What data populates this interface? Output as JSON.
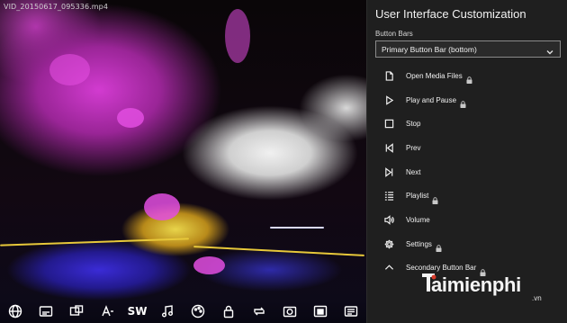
{
  "video": {
    "filename": "VID_20150617_095336.mp4",
    "toolbar": {
      "subtitle_text": "SW",
      "icons": [
        "globe-icon",
        "subtitles-icon",
        "aspect-icon",
        "text-size-icon",
        "music-note-icon",
        "palette-icon",
        "lock-icon",
        "loop-icon",
        "screenshot-icon",
        "picture-in-picture-icon",
        "playlist-screen-icon"
      ]
    }
  },
  "panel": {
    "title": "User Interface Customization",
    "section_label": "Button Bars",
    "dropdown_value": "Primary Button Bar (bottom)",
    "items": [
      {
        "label": "Open Media Files",
        "icon": "file-icon",
        "locked": true
      },
      {
        "label": "Play and Pause",
        "icon": "play-icon",
        "locked": true
      },
      {
        "label": "Stop",
        "icon": "stop-icon",
        "locked": false
      },
      {
        "label": "Prev",
        "icon": "prev-icon",
        "locked": false
      },
      {
        "label": "Next",
        "icon": "next-icon",
        "locked": false
      },
      {
        "label": "Playlist",
        "icon": "playlist-icon",
        "locked": true
      },
      {
        "label": "Volume",
        "icon": "volume-icon",
        "locked": false
      },
      {
        "label": "Settings",
        "icon": "gear-icon",
        "locked": true
      },
      {
        "label": "Secondary Button Bar",
        "icon": "chevron-up-icon",
        "locked": true
      }
    ]
  },
  "watermark": {
    "brand": "aimienphi",
    "suffix": ".vn"
  },
  "colors": {
    "panel_bg": "#1f1f1f",
    "accent_yellow": "#e7c83a",
    "blossom_pink": "#e24de0"
  }
}
